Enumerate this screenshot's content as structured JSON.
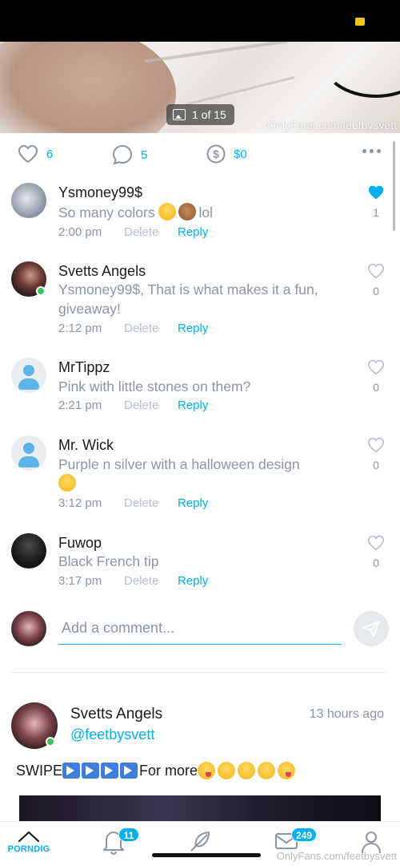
{
  "post": {
    "media_counter": "1 of 15",
    "watermark": "OnlyFans.com/feetbysvett",
    "likes": "6",
    "comments": "5",
    "tips": "$0"
  },
  "comments": [
    {
      "name": "Ysmoney99$",
      "text": "So many colors",
      "text_suffix": "lol",
      "time": "2:00 pm",
      "delete": "Delete",
      "reply": "Reply",
      "likes": "1",
      "liked": true
    },
    {
      "name": "Svetts Angels",
      "text": "Ysmoney99$, That is what makes it a fun, giveaway!",
      "time": "2:12 pm",
      "delete": "Delete",
      "reply": "Reply",
      "likes": "0",
      "liked": false
    },
    {
      "name": "MrTippz",
      "text": "Pink with little stones on them?",
      "time": "2:21 pm",
      "delete": "Delete",
      "reply": "Reply",
      "likes": "0",
      "liked": false
    },
    {
      "name": "Mr. Wick",
      "text": "Purple n silver with a halloween design",
      "time": "3:12 pm",
      "delete": "Delete",
      "reply": "Reply",
      "likes": "0",
      "liked": false
    },
    {
      "name": "Fuwop",
      "text": "Black French tip",
      "time": "3:17 pm",
      "delete": "Delete",
      "reply": "Reply",
      "likes": "0",
      "liked": false
    }
  ],
  "add_comment": {
    "placeholder": "Add a comment..."
  },
  "next_post": {
    "name": "Svetts Angels",
    "handle": "@feetbysvett",
    "time": "13 hours ago",
    "text_start": "SWIPE",
    "text_mid": " For more"
  },
  "nav": {
    "home_label": "PORNDIG",
    "notifications_badge": "11",
    "messages_badge": "249",
    "watermark": "OnlyFans.com/feetbysvett"
  },
  "colors": {
    "accent": "#00aff0",
    "muted": "#8a96a3",
    "online": "#3cc55e"
  }
}
